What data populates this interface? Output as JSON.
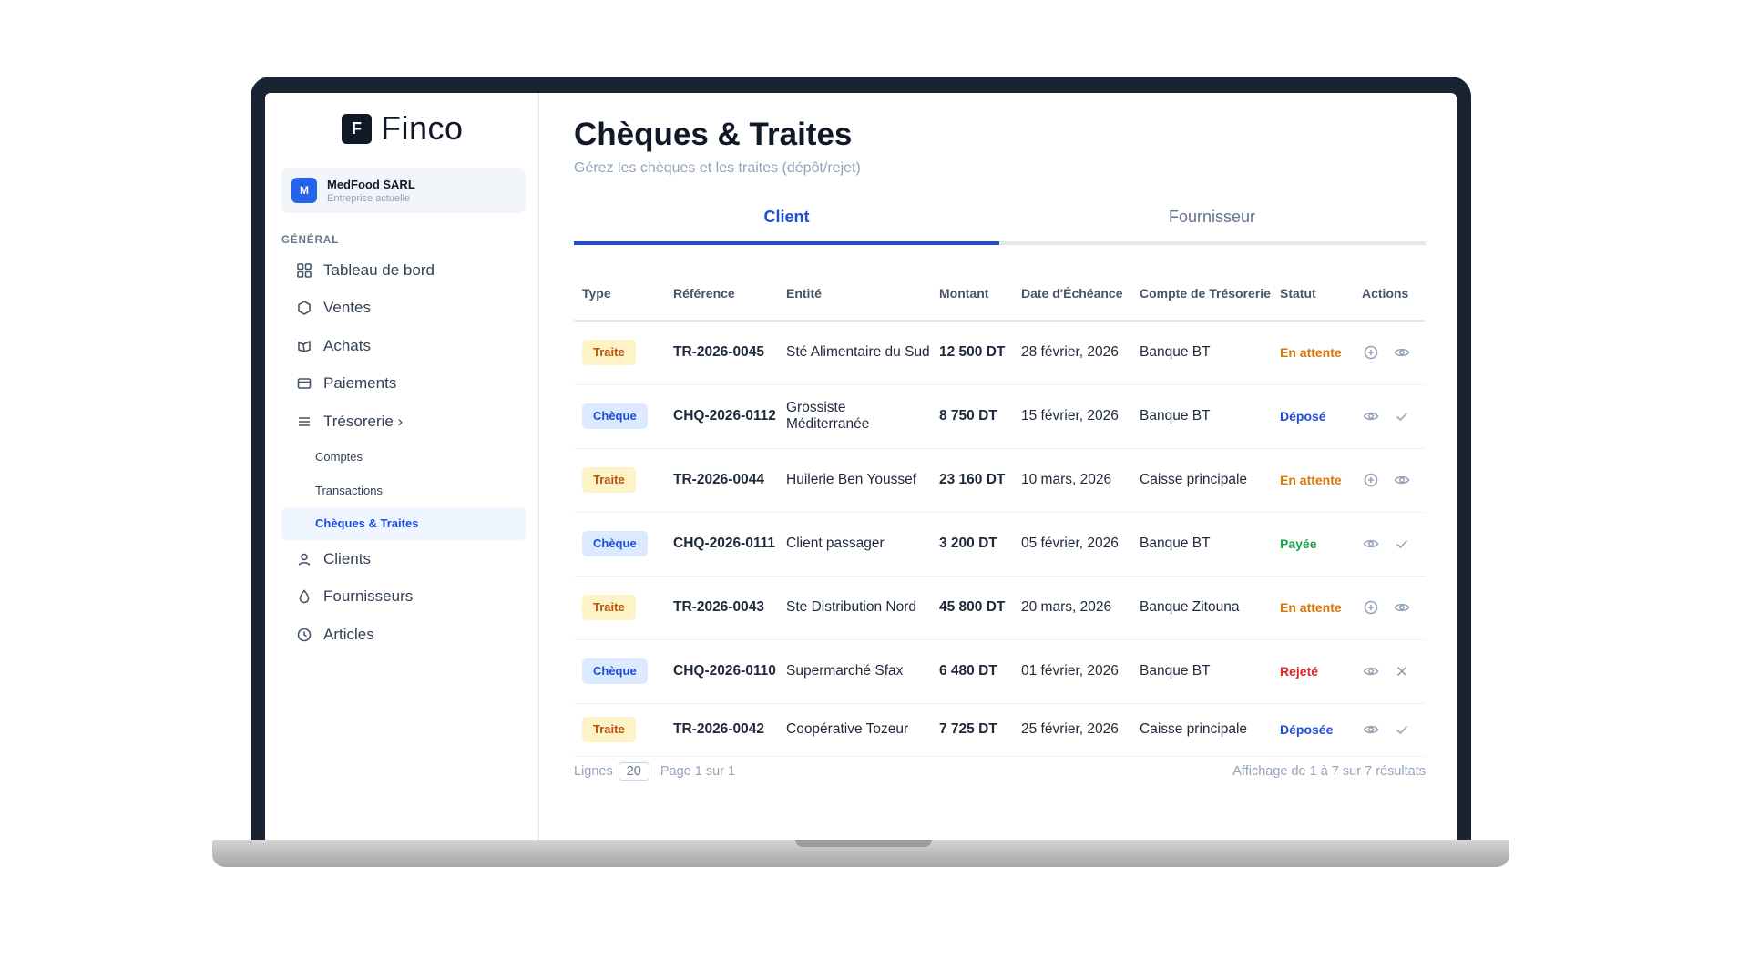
{
  "app": {
    "logo_letter": "F",
    "name": "Finco"
  },
  "company": {
    "avatar": "M",
    "name": "MedFood SARL",
    "subtitle": "Entreprise actuelle"
  },
  "sidebar": {
    "section_label": "GÉNÉRAL",
    "items": [
      {
        "label": "Tableau de bord",
        "icon": "grid-icon"
      },
      {
        "label": "Ventes",
        "icon": "hexagon-icon"
      },
      {
        "label": "Achats",
        "icon": "tag-icon"
      },
      {
        "label": "Paiements",
        "icon": "card-icon"
      },
      {
        "label": "Trésorerie ›",
        "icon": "menu-icon"
      }
    ],
    "sub_items": [
      {
        "label": "Comptes",
        "active": false
      },
      {
        "label": "Transactions",
        "active": false
      },
      {
        "label": "Chèques & Traites",
        "active": true
      }
    ],
    "items_after": [
      {
        "label": "Clients",
        "icon": "user-icon"
      },
      {
        "label": "Fournisseurs",
        "icon": "bell-icon"
      },
      {
        "label": "Articles",
        "icon": "clock-icon"
      }
    ]
  },
  "page": {
    "title": "Chèques & Traites",
    "subtitle": "Gérez les chèques et les traites (dépôt/rejet)"
  },
  "tabs": [
    {
      "label": "Client",
      "active": true
    },
    {
      "label": "Fournisseur",
      "active": false
    }
  ],
  "table": {
    "headers": [
      "Type",
      "Référence",
      "Entité",
      "Montant",
      "Date d'Échéance",
      "Compte de Trésorerie",
      "Statut",
      "Actions"
    ],
    "rows": [
      {
        "type": "Traite",
        "ref": "TR-2026-0045",
        "entity": "Sté Alimentaire du Sud",
        "amount": "12 500 DT",
        "date": "28 février, 2026",
        "account": "Banque BT",
        "status": "En attente",
        "status_color": "#d97706",
        "actions": [
          "plus-circle-icon",
          "eye-icon"
        ]
      },
      {
        "type": "Chèque",
        "ref": "CHQ-2026-0112",
        "entity": "Grossiste Méditerranée",
        "amount": "8 750 DT",
        "date": "15 février, 2026",
        "account": "Banque BT",
        "status": "Déposé",
        "status_color": "#1d4ed8",
        "actions": [
          "eye-icon",
          "check-icon"
        ]
      },
      {
        "type": "Traite",
        "ref": "TR-2026-0044",
        "entity": "Huilerie Ben Youssef",
        "amount": "23 160 DT",
        "date": "10 mars, 2026",
        "account": "Caisse principale",
        "status": "En attente",
        "status_color": "#d97706",
        "actions": [
          "plus-circle-icon",
          "eye-icon"
        ]
      },
      {
        "type": "Chèque",
        "ref": "CHQ-2026-0111",
        "entity": "Client passager",
        "amount": "3 200 DT",
        "date": "05 février, 2026",
        "account": "Banque BT",
        "status": "Payée",
        "status_color": "#16a34a",
        "actions": [
          "eye-icon",
          "check-icon"
        ]
      },
      {
        "type": "Traite",
        "ref": "TR-2026-0043",
        "entity": "Ste Distribution Nord",
        "amount": "45 800 DT",
        "date": "20 mars, 2026",
        "account": "Banque Zitouna",
        "status": "En attente",
        "status_color": "#d97706",
        "actions": [
          "plus-circle-icon",
          "eye-icon"
        ]
      },
      {
        "type": "Chèque",
        "ref": "CHQ-2026-0110",
        "entity": "Supermarché Sfax",
        "amount": "6 480 DT",
        "date": "01 février, 2026",
        "account": "Banque BT",
        "status": "Rejeté",
        "status_color": "#dc2626",
        "actions": [
          "eye-icon",
          "x-icon"
        ]
      },
      {
        "type": "Traite",
        "ref": "TR-2026-0042",
        "entity": "Coopérative Tozeur",
        "amount": "7 725 DT",
        "date": "25 février, 2026",
        "account": "Caisse principale",
        "status": "Déposée",
        "status_color": "#1d4ed8",
        "actions": [
          "eye-icon",
          "check-icon"
        ]
      }
    ]
  },
  "footer": {
    "lines_label": "Lignes",
    "lines_value": "20",
    "page_label": "Page 1 sur 1",
    "summary": "Affichage de 1 à 7 sur 7 résultats"
  }
}
